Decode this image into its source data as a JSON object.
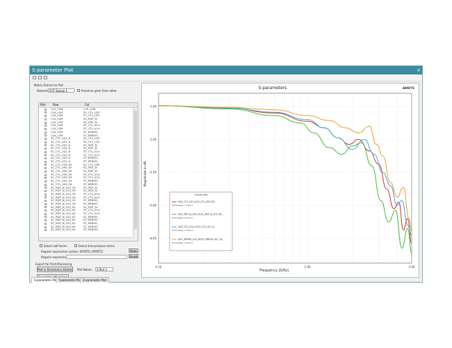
{
  "window": {
    "title": "S-parameter Plot",
    "close_glyph": "×"
  },
  "left": {
    "section_title": "Matrix Entries to Plot",
    "dataset_label": "Dataset:",
    "dataset_value": "SYZ Sweep 1",
    "preserve_label": "Preserve plots from other",
    "col_plot": "Plot",
    "col_row": "Row",
    "col_col": "Col",
    "rows": [
      {
        "row": "CLK_12M",
        "col": "CLK_12M"
      },
      {
        "row": "CLK_12M",
        "col": "SC_CTL_U22"
      },
      {
        "row": "CLK_12M",
        "col": "SC_CTL_U22"
      },
      {
        "row": "CLK_12M",
        "col": "SC_RDT_N"
      },
      {
        "row": "CLK_12M",
        "col": "SC_RDT_N"
      },
      {
        "row": "CLK_12M",
        "col": "ST_CTL_U14"
      },
      {
        "row": "CLK_12M",
        "col": "ST_CTL_U14"
      },
      {
        "row": "CLK_12M",
        "col": "ST_ERROR_"
      },
      {
        "row": "CLK_12M",
        "col": "ST_ERROR_"
      },
      {
        "row": "SC_CTL_U22_6",
        "col": "SC_CTL_U22"
      },
      {
        "row": "SC_CTL_U22_6",
        "col": "SC_CTL_U22"
      },
      {
        "row": "SC_CTL_U22_6",
        "col": "SC_RDT_N"
      },
      {
        "row": "SC_CTL_U22_6",
        "col": "SC_RDT_N"
      },
      {
        "row": "SC_CTL_U22_6",
        "col": "ST_CTL_U14"
      },
      {
        "row": "SC_CTL_U22_6",
        "col": "ST_CTL_U14"
      },
      {
        "row": "SC_CTL_U22_6",
        "col": "ST_ERROR_"
      },
      {
        "row": "SC_CTL_U22_6",
        "col": "ST_ERROR_"
      },
      {
        "row": "SC_CTL_U55_E0",
        "col": "SC_CTL_U55"
      },
      {
        "row": "SC_CTL_U55_E0",
        "col": "SC_RDT_N"
      },
      {
        "row": "SC_CTL_U55_E0",
        "col": "SC_RDT_N"
      },
      {
        "row": "SC_CTL_U55_E0",
        "col": "ST_CTL_U14"
      },
      {
        "row": "SC_CTL_U55_E0",
        "col": "ST_CTL_U14"
      },
      {
        "row": "SC_CTL_U55_E0",
        "col": "ST_ERROR_"
      },
      {
        "row": "SC_CTL_U55_E0",
        "col": "ST_ERROR_"
      },
      {
        "row": "SC_RDT_N_U22_59",
        "col": "SC_RDT_N"
      },
      {
        "row": "SC_RDT_N_U22_59",
        "col": "SC_RDT_N"
      },
      {
        "row": "SC_RDT_N_U22_59",
        "col": "ST_CTL_U14"
      },
      {
        "row": "SC_RDT_N_U22_59",
        "col": "ST_CTL_U14"
      },
      {
        "row": "SC_RDT_N_U22_59",
        "col": "ST_ERROR_"
      },
      {
        "row": "SC_RDT_N_U22_59",
        "col": "ST_ERROR_"
      },
      {
        "row": "SC_RDT_N_U22_61",
        "col": "SC_RDT_N"
      },
      {
        "row": "SC_RDT_N_U22_61",
        "col": "ST_CTL_U14"
      },
      {
        "row": "SC_RDT_N_U22_61",
        "col": "ST_CTL_U14"
      },
      {
        "row": "SC_RDT_N_U22_61",
        "col": "ST_ERROR_"
      },
      {
        "row": "SC_RDT_N_U22_61",
        "col": "ST_ERROR_"
      },
      {
        "row": "SC_RDT_N_U22_61",
        "col": "ST_ERROR_"
      },
      {
        "row": "SC_RDT_N_U22_61",
        "col": "ST_ERROR_"
      },
      {
        "row": "SC_RDT_N_U22_61",
        "col": "ST_ERROR_"
      }
    ],
    "select_self": "Select self terms",
    "select_transmission": "Select transmission terms",
    "regex_hint": "Regular expression syntax: (PORT1):(PORT2)",
    "regex_label": "Regular expression:",
    "select_btn": "Selec",
    "unselect_btn": "Unsele",
    "export_title": "Export for Post-Processing",
    "plot_btn": "Plot in Electronics Desktop",
    "plot_name_label": "Plot Name:",
    "plot_name_value": "S Plot 1",
    "export_btn": "Export to ndExplorer"
  },
  "tabs": [
    "S-parameter Plot",
    "Y-parameter Plot",
    "Z-parameter Plot"
  ],
  "chart_data": {
    "type": "line",
    "title": "S-parameters",
    "brand": "ANSYS",
    "xlabel": "Frequency [GHz]",
    "ylabel": "Magnitude in dB",
    "x_ticks": [
      "0.10",
      "1.00",
      "5.00"
    ],
    "y_ticks": [
      "0.00",
      "-2.00",
      "-4.00",
      "-6.00",
      "-8.00"
    ],
    "ylim": [
      -9.5,
      0.8
    ],
    "legend_title": "Curve Info",
    "legend_placement": "bottom-left",
    "series": [
      {
        "name": "S(SC_CTL_U22_6,SC_CTL_U55_E0)",
        "sub": "SYZ Sweep 1 S Plot 1",
        "color": "#d42b2b",
        "x": [
          0.1,
          0.3,
          0.6,
          1.0,
          1.3,
          1.6,
          1.9,
          2.2,
          2.6,
          3.0,
          3.4,
          3.8,
          4.1,
          4.4,
          4.7,
          5.0
        ],
        "y": [
          0.05,
          -0.1,
          -0.4,
          -0.9,
          -1.3,
          -1.9,
          -2.3,
          -2.0,
          -2.7,
          -3.5,
          -5.0,
          -6.2,
          -5.8,
          -7.5,
          -6.8,
          -8.3
        ]
      },
      {
        "name": "S(SC_RDT_N_U22_59,SC_RDT_N_U22_61)",
        "sub": "SYZ Sweep 1 S Plot 1",
        "color": "#3fbf2e",
        "x": [
          0.1,
          0.3,
          0.6,
          0.9,
          1.1,
          1.4,
          1.7,
          2.0,
          2.3,
          2.7,
          3.1,
          3.5,
          3.9,
          4.3,
          4.7,
          5.0
        ],
        "y": [
          0.05,
          -0.15,
          -0.55,
          -1.0,
          -1.6,
          -2.5,
          -2.9,
          -2.4,
          -2.2,
          -3.6,
          -5.7,
          -7.0,
          -6.3,
          -8.6,
          -7.4,
          -8.9
        ]
      },
      {
        "name": "S(ST_CTL_U14_23,ST_CTL_U22_9)",
        "sub": "SYZ Sweep 1 S Plot 1",
        "color": "#3aa5e0",
        "x": [
          0.1,
          0.3,
          0.6,
          1.0,
          1.3,
          1.6,
          2.0,
          2.4,
          2.8,
          3.2,
          3.6,
          4.0,
          4.3,
          4.7,
          5.0
        ],
        "y": [
          0.05,
          -0.1,
          -0.35,
          -0.8,
          -1.3,
          -1.9,
          -2.6,
          -2.0,
          -2.9,
          -4.0,
          -4.8,
          -6.0,
          -5.7,
          -7.2,
          -7.8
        ]
      },
      {
        "name": "S(ST_ERROR_U14_58,ST_ERROR_U22_12)",
        "sub": "SYZ Sweep 1 S Plot 1",
        "color": "#f29a22",
        "x": [
          0.1,
          0.3,
          0.6,
          1.0,
          1.4,
          1.8,
          2.2,
          2.6,
          2.9,
          3.2,
          3.6,
          4.0,
          4.4,
          4.8,
          5.0
        ],
        "y": [
          0.05,
          -0.05,
          -0.2,
          -0.55,
          -0.85,
          -1.3,
          -1.6,
          -1.2,
          -2.3,
          -3.0,
          -4.6,
          -5.5,
          -4.9,
          -6.8,
          -7.6
        ]
      }
    ]
  }
}
